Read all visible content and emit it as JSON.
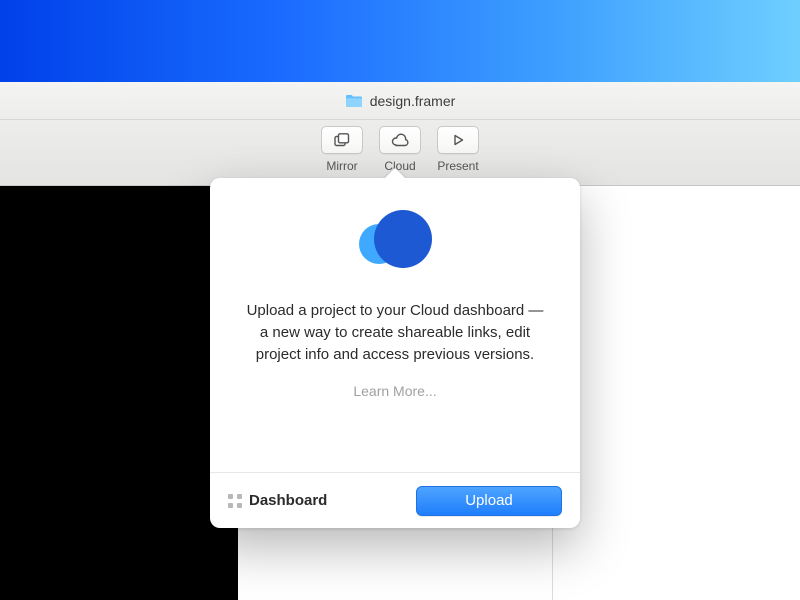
{
  "titlebar": {
    "filename": "design.framer"
  },
  "toolbar": {
    "items": [
      {
        "label": "Mirror"
      },
      {
        "label": "Cloud"
      },
      {
        "label": "Present"
      }
    ]
  },
  "popover": {
    "description": "Upload a project to your Cloud dashboard — a new way to create shareable links, edit project info and access previous versions.",
    "learn_more": "Learn More...",
    "dashboard_label": "Dashboard",
    "upload_label": "Upload"
  }
}
